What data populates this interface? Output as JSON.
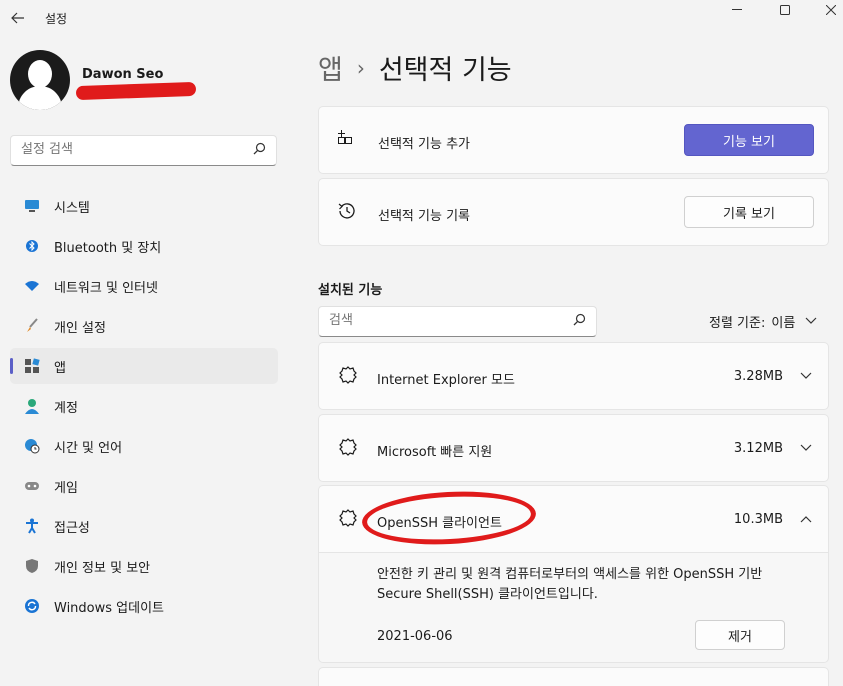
{
  "window": {
    "title": "설정"
  },
  "user": {
    "name": "Dawon Seo"
  },
  "sidebar": {
    "search_placeholder": "설정 검색",
    "items": [
      {
        "label": "시스템",
        "icon": "monitor-icon"
      },
      {
        "label": "Bluetooth 및 장치",
        "icon": "bluetooth-icon"
      },
      {
        "label": "네트워크 및 인터넷",
        "icon": "wifi-icon"
      },
      {
        "label": "개인 설정",
        "icon": "brush-icon"
      },
      {
        "label": "앱",
        "icon": "apps-icon",
        "active": true
      },
      {
        "label": "계정",
        "icon": "person-icon"
      },
      {
        "label": "시간 및 언어",
        "icon": "globe-clock-icon"
      },
      {
        "label": "게임",
        "icon": "gamepad-icon"
      },
      {
        "label": "접근성",
        "icon": "accessibility-icon"
      },
      {
        "label": "개인 정보 및 보안",
        "icon": "shield-icon"
      },
      {
        "label": "Windows 업데이트",
        "icon": "update-icon"
      }
    ]
  },
  "breadcrumb": {
    "parent": "앱",
    "separator": "›",
    "current": "선택적 기능"
  },
  "actions": {
    "add": {
      "label": "선택적 기능 추가",
      "button": "기능 보기"
    },
    "history": {
      "label": "선택적 기능 기록",
      "button": "기록 보기"
    }
  },
  "installed": {
    "title": "설치된 기능",
    "search_placeholder": "검색",
    "sort_label": "정렬 기준:",
    "sort_value": "이름",
    "features": [
      {
        "name": "Internet Explorer 모드",
        "size": "3.28MB"
      },
      {
        "name": "Microsoft 빠른 지원",
        "size": "3.12MB"
      },
      {
        "name": "OpenSSH 클라이언트",
        "size": "10.3MB",
        "description": "안전한 키 관리 및 원격 컴퓨터로부터의 액세스를 위한 OpenSSH 기반 Secure Shell(SSH) 클라이언트입니다.",
        "date": "2021-06-06",
        "remove_label": "제거"
      }
    ]
  },
  "colors": {
    "accent": "#6365d0",
    "annotation": "#e01b1b"
  }
}
